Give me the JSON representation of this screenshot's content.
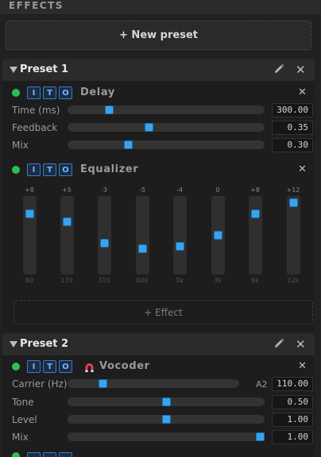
{
  "panel": {
    "title": "EFFECTS"
  },
  "new_preset_label": "+ New preset",
  "iot_labels": [
    "I",
    "T",
    "O"
  ],
  "presets": [
    {
      "name": "Preset 1",
      "effects": [
        {
          "name": "Delay",
          "enabled": true,
          "params": [
            {
              "label": "Time (ms)",
              "value": "300.00",
              "fraction": 0.2
            },
            {
              "label": "Feedback",
              "value": "0.35",
              "fraction": 0.41
            },
            {
              "label": "Mix",
              "value": "0.30",
              "fraction": 0.3
            }
          ]
        },
        {
          "name": "Equalizer",
          "enabled": true,
          "bands": [
            {
              "freq": "60",
              "gain": "+8"
            },
            {
              "freq": "170",
              "gain": "+5"
            },
            {
              "freq": "310",
              "gain": "-3"
            },
            {
              "freq": "600",
              "gain": "-5"
            },
            {
              "freq": "1k",
              "gain": "-4"
            },
            {
              "freq": "3k",
              "gain": "0"
            },
            {
              "freq": "6k",
              "gain": "+8"
            },
            {
              "freq": "12k",
              "gain": "+12"
            }
          ]
        }
      ],
      "add_effect_label": "+ Effect"
    },
    {
      "name": "Preset 2",
      "effects": [
        {
          "name": "Vocoder",
          "enabled": true,
          "carrier": {
            "label": "Carrier (Hz)",
            "note": "A2",
            "value": "110.00",
            "fraction": 0.19
          },
          "params": [
            {
              "label": "Tone",
              "value": "0.50",
              "fraction": 0.5
            },
            {
              "label": "Level",
              "value": "1.00",
              "fraction": 0.5
            },
            {
              "label": "Mix",
              "value": "1.00",
              "fraction": 1.0
            }
          ]
        }
      ]
    }
  ],
  "colors": {
    "accent": "#3aa3ee",
    "led_on": "#2fbf4f",
    "magnet": "#e0405a"
  },
  "icons": [
    "pencil-icon",
    "close-icon",
    "collapse-triangle-icon",
    "magnet-icon"
  ]
}
